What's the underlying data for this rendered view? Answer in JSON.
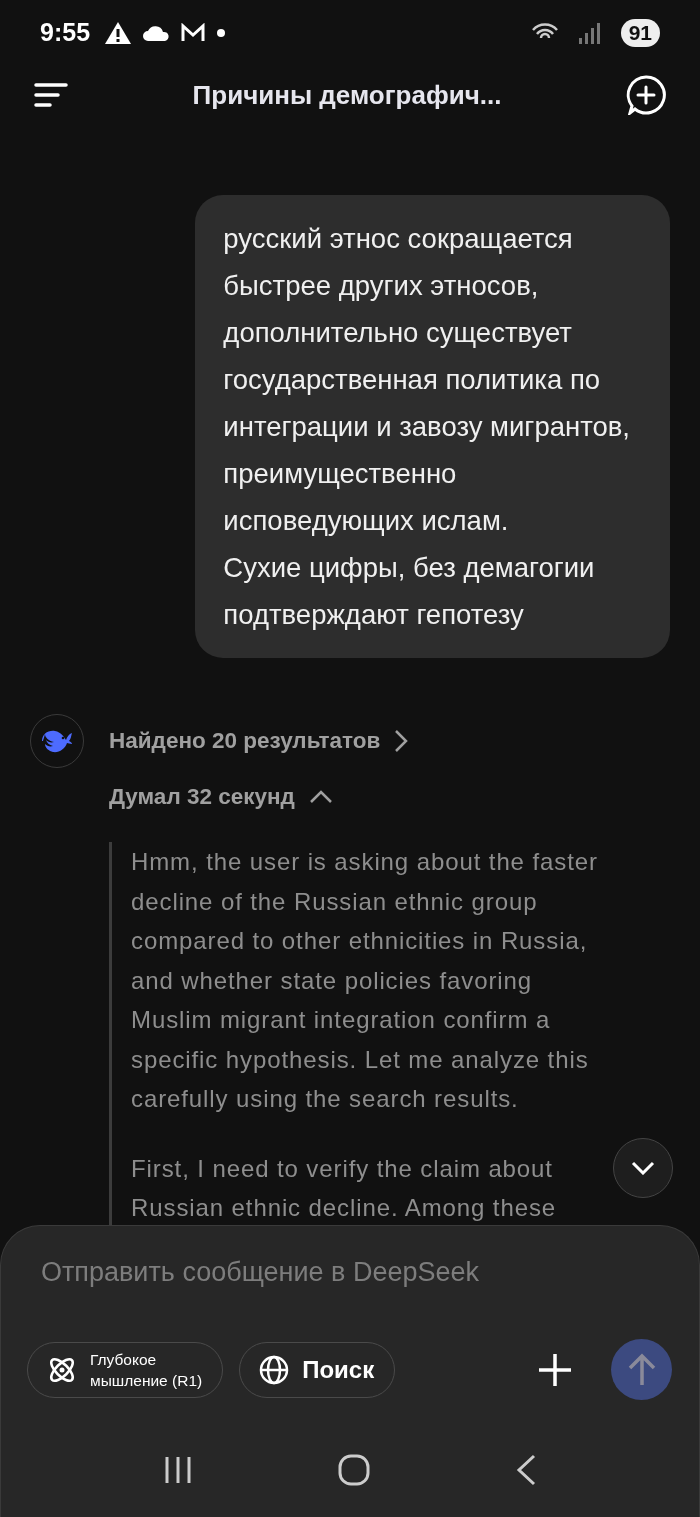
{
  "status_bar": {
    "time": "9:55",
    "battery": "91"
  },
  "header": {
    "title": "Причины демографич..."
  },
  "messages": [
    {
      "kind": "user",
      "text": "русский этнос сокращается\nбыстрее других этносов,\nдополнительно существует\nгосударственная политика по\nинтеграции и завозу мигрантов,\nпреимущественно\nисповедующих ислам.\nСухие цифры, без демагогии\nподтверждают гепотезу"
    },
    {
      "kind": "assistant",
      "search": "Найдено 20 результатов",
      "thought_label": "Думал 32 секунд",
      "expanded": true,
      "thought": [
        "Hmm, the user is asking about the faster\ndecline of the Russian ethnic group\ncompared to other ethnicities in Russia,\nand whether state policies favoring\nMuslim migrant integration confirm a\nspecific hypothesis. Let me analyze this\ncarefully using the search results.",
        "First, I need to verify the claim about\nRussian ethnic decline. Among these"
      ]
    }
  ],
  "composer": {
    "placeholder": "Отправить сообщение в DeepSeek",
    "toggles": [
      {
        "kind": "deepthink",
        "label": "Глубокое\nмышление (R1)",
        "on": false
      },
      {
        "kind": "search",
        "label": "Поиск",
        "on": false
      }
    ],
    "send_disabled": true
  }
}
